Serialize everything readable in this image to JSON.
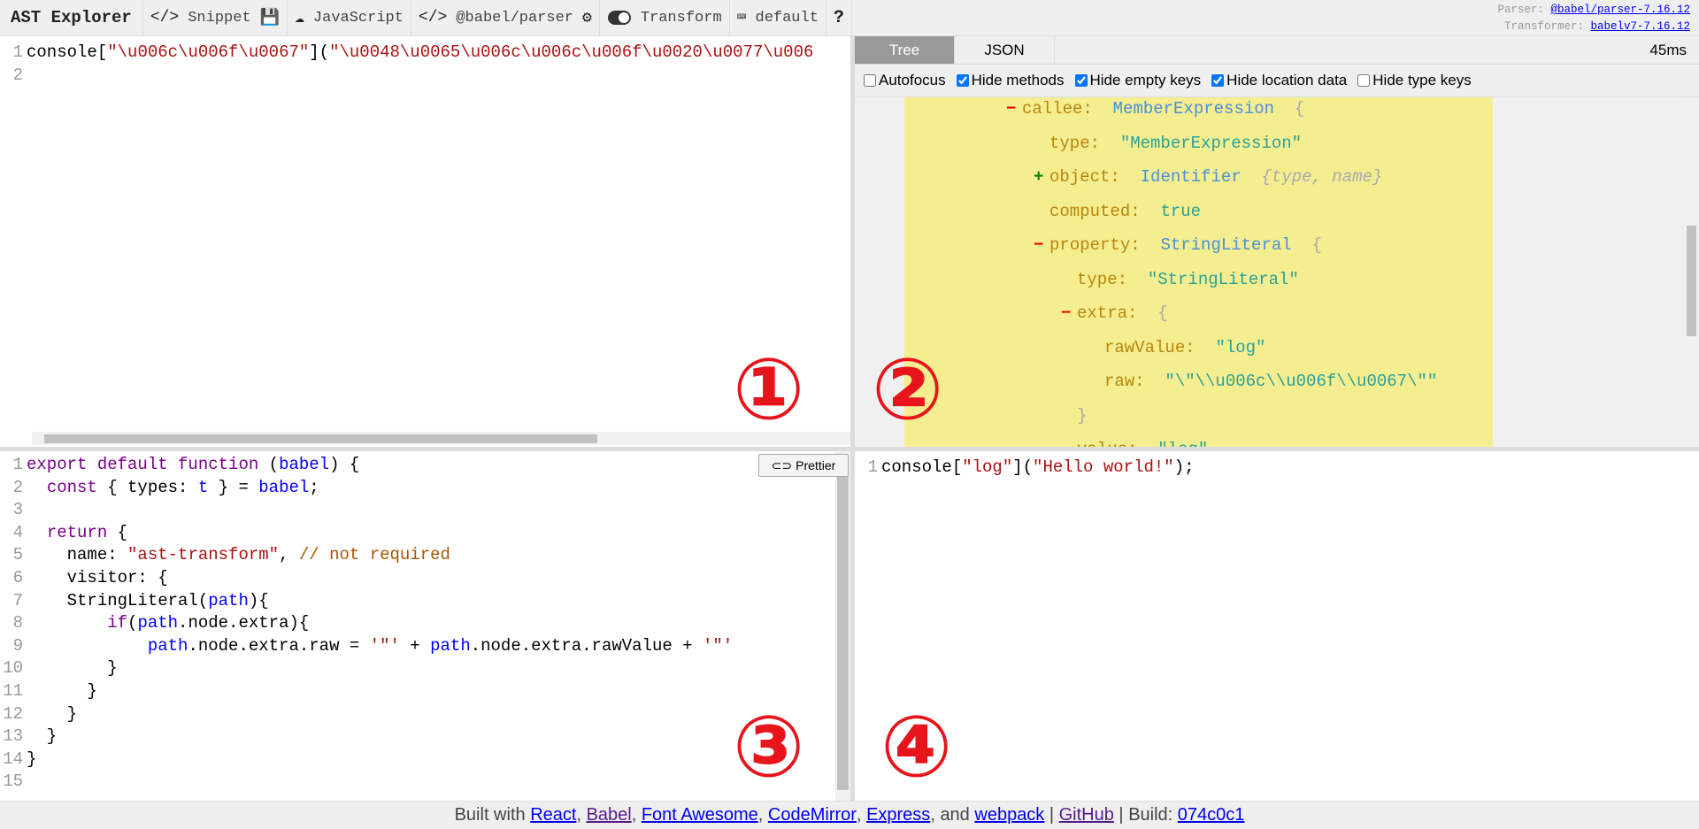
{
  "toolbar": {
    "title": "AST Explorer",
    "snippet": "Snippet",
    "language": "JavaScript",
    "parser": "@babel/parser",
    "transform": "Transform",
    "keymap": "default",
    "help": "?"
  },
  "versions": {
    "parser_label": "Parser:",
    "parser": "@babel/parser-7.16.12",
    "transformer_label": "Transformer:",
    "transformer": "babelv7-7.16.12"
  },
  "source": {
    "lines": [
      [
        [
          "console",
          "pl"
        ],
        [
          "[",
          "pl"
        ],
        [
          "\"\\u006c\\u006f\\u0067\"",
          "str"
        ],
        [
          "](",
          "pl"
        ],
        [
          "\"\\u0048\\u0065\\u006c\\u006c\\u006f\\u0020\\u0077\\u006",
          "str"
        ]
      ],
      []
    ]
  },
  "tabs": [
    {
      "label": "Tree"
    },
    {
      "label": "JSON"
    }
  ],
  "parse_time": "45ms",
  "options": [
    {
      "label": "Autofocus",
      "checked": false
    },
    {
      "label": "Hide methods",
      "checked": true
    },
    {
      "label": "Hide empty keys",
      "checked": true
    },
    {
      "label": "Hide location data",
      "checked": true
    },
    {
      "label": "Hide type keys",
      "checked": false
    }
  ],
  "tree": [
    {
      "toggle": "−",
      "key": "callee:",
      "type": "MemberExpression",
      "value": "",
      "brace": "{"
    },
    {
      "toggle": "",
      "key": "type:",
      "type": "",
      "value": "\"MemberExpression\"",
      "brace": ""
    },
    {
      "toggle": "+",
      "key": "object:",
      "type": "Identifier",
      "value": "",
      "brace": "{type, name}"
    },
    {
      "toggle": "",
      "key": "computed:",
      "type": "",
      "value": "true",
      "brace": ""
    },
    {
      "toggle": "−",
      "key": "property:",
      "type": "StringLiteral",
      "value": "",
      "brace": "{"
    },
    {
      "toggle": "",
      "key": "type:",
      "type": "",
      "value": "\"StringLiteral\"",
      "brace": ""
    },
    {
      "toggle": "−",
      "key": "extra:",
      "type": "",
      "value": "",
      "brace": "{"
    },
    {
      "toggle": "",
      "key": "rawValue:",
      "type": "",
      "value": "\"log\"",
      "brace": ""
    },
    {
      "toggle": "",
      "key": "raw:",
      "type": "",
      "value": "\"\\\"\\\\u006c\\\\u006f\\\\u0067\\\"\"",
      "brace": ""
    },
    {
      "toggle": "",
      "key": "",
      "type": "",
      "value": "",
      "brace": "}"
    },
    {
      "toggle": "",
      "key": "value:",
      "type": "",
      "value": "\"log\"",
      "brace": ""
    }
  ],
  "transform": {
    "prettier": "Prettier",
    "lines": [
      [
        [
          "export default function ",
          "kw"
        ],
        [
          "(",
          "pl"
        ],
        [
          "babel",
          "def"
        ],
        [
          ") {",
          "pl"
        ]
      ],
      [
        [
          "  ",
          "pl"
        ],
        [
          "const",
          "kw"
        ],
        [
          " { types: ",
          "pl"
        ],
        [
          "t",
          "def"
        ],
        [
          " } = ",
          "pl"
        ],
        [
          "babel",
          "def"
        ],
        [
          ";",
          "pl"
        ]
      ],
      [],
      [
        [
          "  ",
          "pl"
        ],
        [
          "return",
          "kw"
        ],
        [
          " {",
          "pl"
        ]
      ],
      [
        [
          "    name: ",
          "pl"
        ],
        [
          "\"ast-transform\"",
          "str"
        ],
        [
          ", ",
          "pl"
        ],
        [
          "// not required",
          "com"
        ]
      ],
      [
        [
          "    visitor: {",
          "pl"
        ]
      ],
      [
        [
          "    StringLiteral(",
          "pl"
        ],
        [
          "path",
          "def"
        ],
        [
          "){",
          "pl"
        ]
      ],
      [
        [
          "        ",
          "pl"
        ],
        [
          "if",
          "kw"
        ],
        [
          "(",
          "pl"
        ],
        [
          "path",
          "def"
        ],
        [
          ".node.extra){",
          "pl"
        ]
      ],
      [
        [
          "            ",
          "pl"
        ],
        [
          "path",
          "def"
        ],
        [
          ".node.extra.raw = ",
          "pl"
        ],
        [
          "'\"'",
          "str"
        ],
        [
          " + ",
          "pl"
        ],
        [
          "path",
          "def"
        ],
        [
          ".node.extra.rawValue + ",
          "pl"
        ],
        [
          "'\"'",
          "str"
        ]
      ],
      [
        [
          "        }",
          "pl"
        ]
      ],
      [
        [
          "      }",
          "pl"
        ]
      ],
      [
        [
          "    }",
          "pl"
        ]
      ],
      [
        [
          "  }",
          "pl"
        ]
      ],
      [
        [
          "}",
          "pl"
        ]
      ],
      []
    ]
  },
  "output": {
    "lines": [
      [
        [
          "console[",
          "pl"
        ],
        [
          "\"log\"",
          "str"
        ],
        [
          "](",
          "pl"
        ],
        [
          "\"Hello world!\"",
          "str"
        ],
        [
          ");",
          "pl"
        ]
      ]
    ]
  },
  "annotations": [
    "①",
    "②",
    "③",
    "④"
  ],
  "footer": {
    "built_with": "Built with",
    "links": [
      "React",
      "Babel",
      "Font Awesome",
      "CodeMirror",
      "Express",
      "webpack"
    ],
    "and": "and",
    "github": "GitHub",
    "build_label": "Build:",
    "build": "074c0c1"
  }
}
